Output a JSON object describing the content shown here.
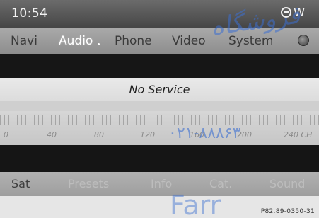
{
  "status_bar": {
    "time": "10:54",
    "compass_heading": "W"
  },
  "main_menu": {
    "items": [
      {
        "label": "Navi",
        "active": false
      },
      {
        "label": "Audio",
        "active": true
      },
      {
        "label": "Phone",
        "active": false
      },
      {
        "label": "Video",
        "active": false
      },
      {
        "label": "System",
        "active": false
      }
    ],
    "settings_icon": "circle-icon"
  },
  "service": {
    "status_text": "No Service"
  },
  "frequency_scale": {
    "labels": [
      "0",
      "40",
      "80",
      "120",
      "160",
      "200",
      "240 CH"
    ]
  },
  "softkeys": {
    "items": [
      {
        "label": "Sat",
        "enabled": true
      },
      {
        "label": "Presets",
        "enabled": false
      },
      {
        "label": "Info",
        "enabled": false
      },
      {
        "label": "Cat.",
        "enabled": false
      },
      {
        "label": "Sound",
        "enabled": false
      }
    ]
  },
  "footer": {
    "code": "P82.89-0350-31"
  },
  "watermark": {
    "arabic": "فروشگاه",
    "phone": "۰۲۱-۸۸۸۶۳",
    "brand": "Farr"
  }
}
